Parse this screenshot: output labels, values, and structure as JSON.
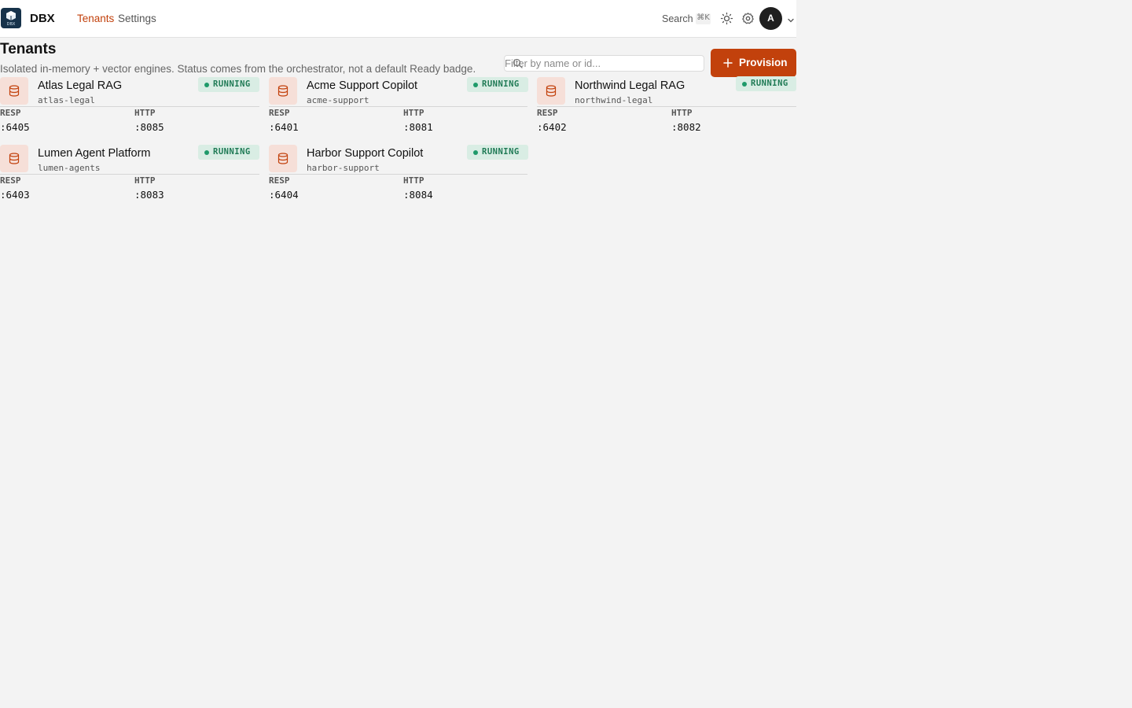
{
  "app": {
    "name": "DBX",
    "logo_caption": "DBX",
    "colors": {
      "accent": "#c2410c",
      "running": "#1f9a6a",
      "header_bg": "#ffffff",
      "page_bg": "#f3f3f3"
    }
  },
  "nav": {
    "items": [
      {
        "label": "Tenants",
        "active": true
      },
      {
        "label": "Settings",
        "active": false
      }
    ]
  },
  "header_actions": {
    "search_label": "Search",
    "search_shortcut": "⌘K",
    "icons": [
      "sun-icon",
      "gear-icon",
      "chevron-down-icon"
    ],
    "avatar_initial": "A"
  },
  "page": {
    "title": "Tenants",
    "subtitle": "Isolated in-memory + vector engines. Status comes from the orchestrator, not a default Ready badge.",
    "filter_placeholder": "Filter by name or id...",
    "filter_value": "",
    "provision_label": "Provision"
  },
  "tenants": [
    {
      "name": "Atlas Legal RAG",
      "id": "atlas-legal",
      "status": "RUNNING",
      "resp_label": "RESP",
      "resp": ":6405",
      "http_label": "HTTP",
      "http": ":8085"
    },
    {
      "name": "Acme Support Copilot",
      "id": "acme-support",
      "status": "RUNNING",
      "resp_label": "RESP",
      "resp": ":6401",
      "http_label": "HTTP",
      "http": ":8081"
    },
    {
      "name": "Northwind Legal RAG",
      "id": "northwind-legal",
      "status": "RUNNING",
      "resp_label": "RESP",
      "resp": ":6402",
      "http_label": "HTTP",
      "http": ":8082"
    },
    {
      "name": "Lumen Agent Platform",
      "id": "lumen-agents",
      "status": "RUNNING",
      "resp_label": "RESP",
      "resp": ":6403",
      "http_label": "HTTP",
      "http": ":8083"
    },
    {
      "name": "Harbor Support Copilot",
      "id": "harbor-support",
      "status": "RUNNING",
      "resp_label": "RESP",
      "resp": ":6404",
      "http_label": "HTTP",
      "http": ":8084"
    }
  ]
}
